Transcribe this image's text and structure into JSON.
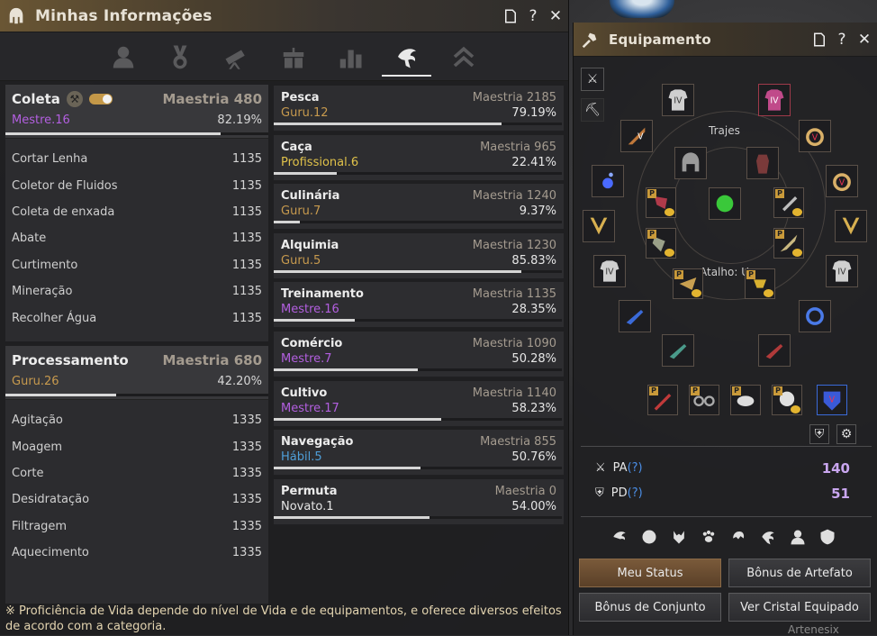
{
  "left_window": {
    "title": "Minhas Informações",
    "tabs": [
      {
        "name": "profile",
        "icon": "person-icon"
      },
      {
        "name": "achievements",
        "icon": "medal-icon"
      },
      {
        "name": "knowledge",
        "icon": "telescope-icon"
      },
      {
        "name": "gifts",
        "icon": "gift-icon"
      },
      {
        "name": "statistics",
        "icon": "bars-icon"
      },
      {
        "name": "life-skills",
        "icon": "life-skill-icon"
      },
      {
        "name": "rank",
        "icon": "chevrons-up-icon"
      }
    ],
    "coleta": {
      "title": "Coleta",
      "mastery": "Maestria 480",
      "level": "Mestre.16",
      "percent": "82.19%",
      "progress": 0.82,
      "items": [
        {
          "label": "Cortar Lenha",
          "value": "1135"
        },
        {
          "label": "Coletor de Fluidos",
          "value": "1135"
        },
        {
          "label": "Coleta de enxada",
          "value": "1135"
        },
        {
          "label": "Abate",
          "value": "1135"
        },
        {
          "label": "Curtimento",
          "value": "1135"
        },
        {
          "label": "Mineração",
          "value": "1135"
        },
        {
          "label": "Recolher Água",
          "value": "1135"
        }
      ]
    },
    "processamento": {
      "title": "Processamento",
      "mastery": "Maestria 680",
      "level": "Guru.26",
      "percent": "42.20%",
      "progress": 0.42,
      "items": [
        {
          "label": "Agitação",
          "value": "1335"
        },
        {
          "label": "Moagem",
          "value": "1335"
        },
        {
          "label": "Corte",
          "value": "1335"
        },
        {
          "label": "Desidratação",
          "value": "1335"
        },
        {
          "label": "Filtragem",
          "value": "1335"
        },
        {
          "label": "Aquecimento",
          "value": "1335"
        }
      ]
    },
    "skills": [
      {
        "name": "Pesca",
        "mastery": "Maestria 2185",
        "level": "Guru.12",
        "tier": "guru",
        "percent": "79.19%",
        "progress": 0.79
      },
      {
        "name": "Caça",
        "mastery": "Maestria 965",
        "level": "Profissional.6",
        "tier": "prof",
        "percent": "22.41%",
        "progress": 0.22
      },
      {
        "name": "Culinária",
        "mastery": "Maestria 1240",
        "level": "Guru.7",
        "tier": "guru",
        "percent": "9.37%",
        "progress": 0.09
      },
      {
        "name": "Alquimia",
        "mastery": "Maestria 1230",
        "level": "Guru.5",
        "tier": "guru",
        "percent": "85.83%",
        "progress": 0.86
      },
      {
        "name": "Treinamento",
        "mastery": "Maestria 1135",
        "level": "Mestre.16",
        "tier": "mestre",
        "percent": "28.35%",
        "progress": 0.28
      },
      {
        "name": "Comércio",
        "mastery": "Maestria 1090",
        "level": "Mestre.7",
        "tier": "mestre",
        "percent": "50.28%",
        "progress": 0.5
      },
      {
        "name": "Cultivo",
        "mastery": "Maestria 1140",
        "level": "Mestre.17",
        "tier": "mestre",
        "percent": "58.23%",
        "progress": 0.58
      },
      {
        "name": "Navegação",
        "mastery": "Maestria 855",
        "level": "Hábil.5",
        "tier": "hab",
        "percent": "50.76%",
        "progress": 0.51
      },
      {
        "name": "Permuta",
        "mastery": "Maestria 0",
        "level": "Novato.1",
        "tier": "nov",
        "percent": "54.00%",
        "progress": 0.54
      }
    ],
    "note": "※ Proficiência de Vida depende do nível de Vida e de equipamentos, e oferece diversos efeitos de acordo com a categoria."
  },
  "right_window": {
    "title": "Equipamento",
    "costumes_label": "Trajes",
    "shortcut_label": "Atalho: U",
    "ap_label": "PA(?)",
    "ap_value": "140",
    "dp_label": "PD(?)",
    "dp_value": "51",
    "buttons": {
      "my_status": "Meu Status",
      "artifact_bonus": "Bônus de Artefato",
      "set_bonus": "Bônus de Conjunto",
      "view_crystal": "Ver Cristal Equipado"
    },
    "bg_text": "Artenesix"
  }
}
